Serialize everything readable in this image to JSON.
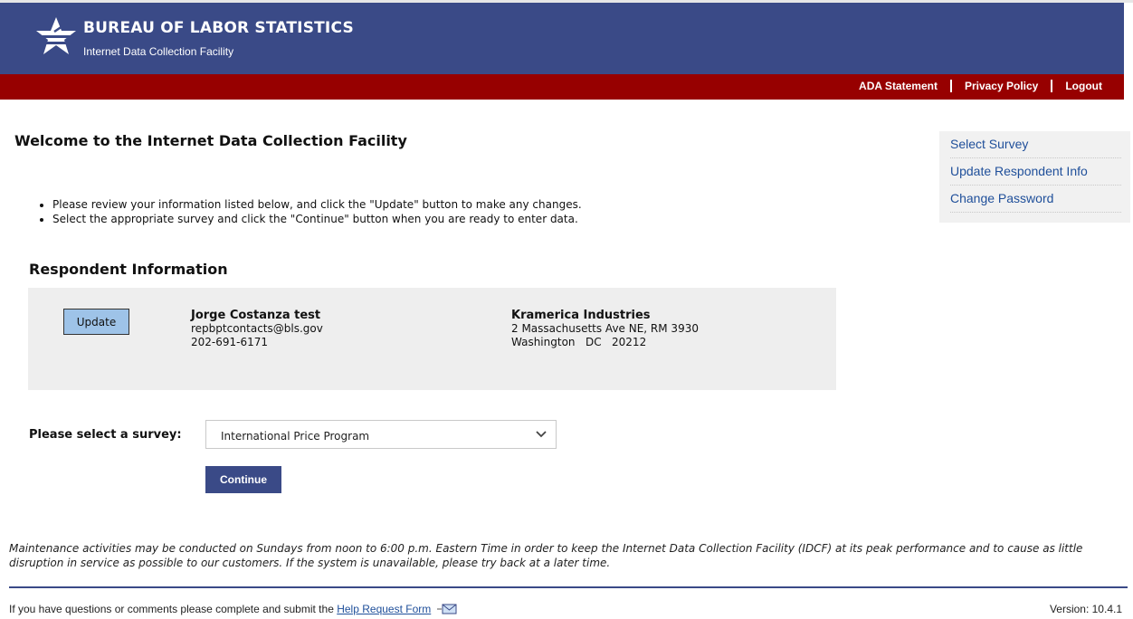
{
  "header": {
    "title": "BUREAU OF LABOR STATISTICS",
    "subtitle": "Internet Data Collection Facility",
    "nav": [
      "ADA Statement",
      "Privacy Policy",
      "Logout"
    ]
  },
  "welcome": "Welcome to the Internet Data Collection Facility",
  "instructions": [
    "Please review your information listed below, and click the \"Update\" button to make any changes.",
    "Select the appropriate survey and click the \"Continue\" button when you are ready to enter data."
  ],
  "side_nav": [
    "Select Survey",
    "Update Respondent Info",
    "Change Password"
  ],
  "respondent": {
    "heading": "Respondent Information",
    "update_label": "Update",
    "name": "Jorge Costanza test",
    "email": "repbptcontacts@bls.gov",
    "phone": "202-691-6171",
    "company": "Kramerica Industries",
    "address1": "2 Massachusetts Ave NE, RM 3930",
    "address2": "Washington   DC   20212"
  },
  "survey": {
    "label": "Please select a survey:",
    "selected": "International Price Program",
    "continue_label": "Continue"
  },
  "maintenance": "Maintenance activities may be conducted on Sundays from noon to 6:00 p.m. Eastern Time in order to keep the Internet Data Collection Facility (IDCF) at its peak performance and to cause as little disruption in service as possible to our customers. If the system is unavailable, please try back at a later time.",
  "footer": {
    "text": "If you have questions or comments please complete and submit the",
    "link": "Help Request Form",
    "version": "Version: 10.4.1"
  },
  "colors": {
    "header_bg": "#3a4a87",
    "redbar_bg": "#970000",
    "link": "#1f4f9a"
  },
  "icons": [
    "bls-star-logo-icon",
    "chevron-down-icon",
    "mail-icon"
  ]
}
